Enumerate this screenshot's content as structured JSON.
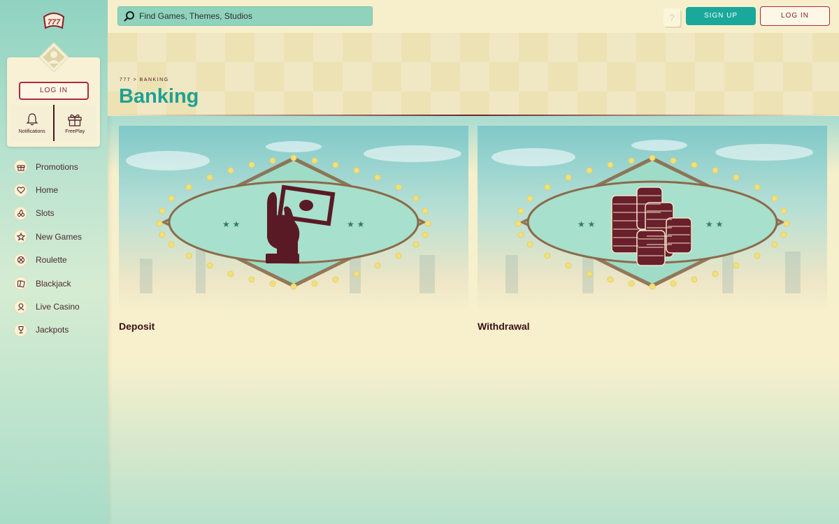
{
  "sidebar": {
    "logo_text": "777",
    "login_label": "LOG IN",
    "quick": [
      {
        "label": "Notifications",
        "icon": "bell-icon"
      },
      {
        "label": "FreePlay",
        "icon": "gift-icon"
      }
    ],
    "nav": [
      {
        "label": "Promotions",
        "icon": "gift-icon"
      },
      {
        "label": "Home",
        "icon": "heart-icon"
      },
      {
        "label": "Slots",
        "icon": "cherries-icon"
      },
      {
        "label": "New Games",
        "icon": "star-icon"
      },
      {
        "label": "Roulette",
        "icon": "roulette-icon"
      },
      {
        "label": "Blackjack",
        "icon": "cards-icon"
      },
      {
        "label": "Live Casino",
        "icon": "dealer-icon"
      },
      {
        "label": "Jackpots",
        "icon": "trophy-icon"
      }
    ]
  },
  "topbar": {
    "search_placeholder": "Find Games, Themes, Studios",
    "help_label": "?",
    "signup_label": "SIGN UP",
    "login_label": "LOG IN"
  },
  "header": {
    "breadcrumb": "777 > BANKING",
    "title": "Banking"
  },
  "cards": [
    {
      "label": "Deposit",
      "icon": "hand-cash-icon"
    },
    {
      "label": "Withdrawal",
      "icon": "chip-stacks-icon"
    }
  ],
  "colors": {
    "accent": "#1aa89b",
    "brand_red": "#b0283e",
    "maroon": "#5a1a25",
    "cream": "#f7efc9",
    "mint": "#8fd3c0"
  }
}
